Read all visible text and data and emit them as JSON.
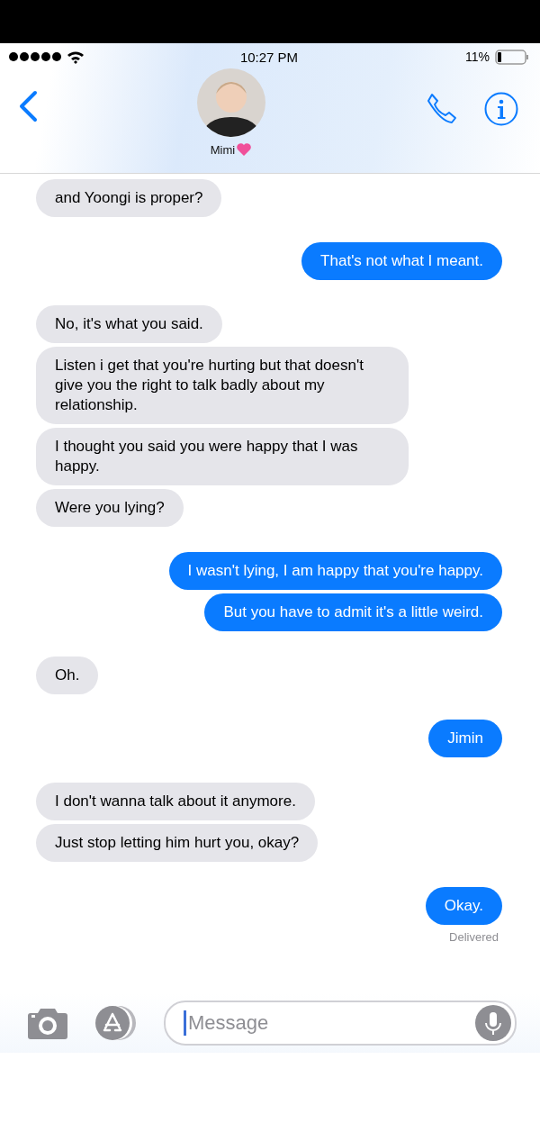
{
  "status_bar": {
    "time": "10:27 PM",
    "battery_percent": "11%"
  },
  "contact": {
    "name": "Mimi"
  },
  "groups": [
    {
      "kind": "incoming",
      "messages": [
        "and Yoongi is proper?"
      ]
    },
    {
      "kind": "outgoing",
      "messages": [
        "That's not what I meant."
      ]
    },
    {
      "kind": "incoming",
      "messages": [
        "No, it's what you said.",
        "Listen i get that you're hurting but that doesn't give you the right to talk badly about my relationship.",
        "I thought you said you were happy that I was happy.",
        "Were you lying?"
      ]
    },
    {
      "kind": "outgoing",
      "messages": [
        "I wasn't lying, I am happy that you're happy.",
        "But you have to admit it's a little weird."
      ]
    },
    {
      "kind": "incoming",
      "messages": [
        "Oh."
      ]
    },
    {
      "kind": "outgoing",
      "messages": [
        "Jimin"
      ]
    },
    {
      "kind": "incoming",
      "messages": [
        "I don't wanna talk about it anymore.",
        "Just stop letting him hurt you, okay?"
      ]
    },
    {
      "kind": "outgoing",
      "messages": [
        "Okay."
      ],
      "status": "Delivered"
    }
  ],
  "composer": {
    "placeholder": "Message"
  }
}
